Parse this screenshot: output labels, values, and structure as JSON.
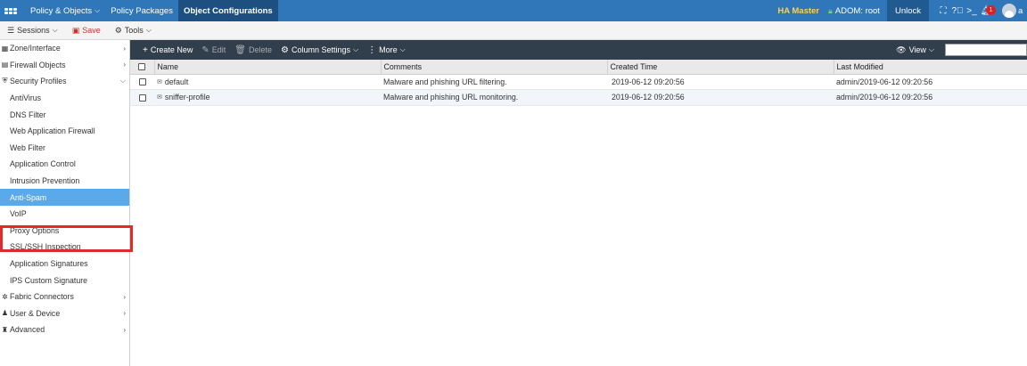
{
  "topbar": {
    "nav": [
      {
        "label": "Policy & Objects",
        "has_caret": true,
        "active": false
      },
      {
        "label": "Policy Packages",
        "has_caret": false,
        "active": false
      },
      {
        "label": "Object Configurations",
        "has_caret": false,
        "active": true
      }
    ],
    "ha_status": "HA Master",
    "adom_label": "ADOM: root",
    "unlock_label": "Unlock",
    "notification_count": "1",
    "user_initial": "a"
  },
  "subbar": {
    "sessions_label": "Sessions",
    "save_label": "Save",
    "tools_label": "Tools"
  },
  "sidebar": {
    "items": [
      {
        "label": "Zone/Interface",
        "level": "top",
        "icon": "zone-icon",
        "arrow": "right"
      },
      {
        "label": "Firewall Objects",
        "level": "top",
        "icon": "firewall-icon",
        "arrow": "right"
      },
      {
        "label": "Security Profiles",
        "level": "top",
        "icon": "shield-icon",
        "arrow": "down"
      },
      {
        "label": "AntiVirus",
        "level": "child"
      },
      {
        "label": "DNS Filter",
        "level": "child"
      },
      {
        "label": "Web Application Firewall",
        "level": "child"
      },
      {
        "label": "Web Filter",
        "level": "child"
      },
      {
        "label": "Application Control",
        "level": "child"
      },
      {
        "label": "Intrusion Prevention",
        "level": "child"
      },
      {
        "label": "Anti-Spam",
        "level": "child",
        "selected": true
      },
      {
        "label": "VoIP",
        "level": "child"
      },
      {
        "label": "Proxy Options",
        "level": "child"
      },
      {
        "label": "SSL/SSH Inspection",
        "level": "child"
      },
      {
        "label": "Application Signatures",
        "level": "child"
      },
      {
        "label": "IPS Custom Signature",
        "level": "child"
      },
      {
        "label": "Fabric Connectors",
        "level": "top",
        "icon": "connector-icon",
        "arrow": "right"
      },
      {
        "label": "User & Device",
        "level": "top",
        "icon": "user-icon",
        "arrow": "right"
      },
      {
        "label": "Advanced",
        "level": "top",
        "icon": "advanced-icon",
        "arrow": "right"
      }
    ]
  },
  "toolbar": {
    "create_new": "Create New",
    "edit": "Edit",
    "delete": "Delete",
    "column_settings": "Column Settings",
    "more": "More",
    "view": "View"
  },
  "table": {
    "columns": [
      "Name",
      "Comments",
      "Created Time",
      "Last Modified"
    ],
    "rows": [
      {
        "name": "default",
        "comments": "Malware and phishing URL filtering.",
        "created": "2019-06-12 09:20:56",
        "modified": "admin/2019-06-12 09:20:56"
      },
      {
        "name": "sniffer-profile",
        "comments": "Malware and phishing URL monitoring.",
        "created": "2019-06-12 09:20:56",
        "modified": "admin/2019-06-12 09:20:56"
      }
    ]
  },
  "colors": {
    "topbar": "#2f77b8",
    "toolbar": "#313e4b",
    "selected": "#5aa9ea",
    "highlight": "#e12a2a"
  }
}
